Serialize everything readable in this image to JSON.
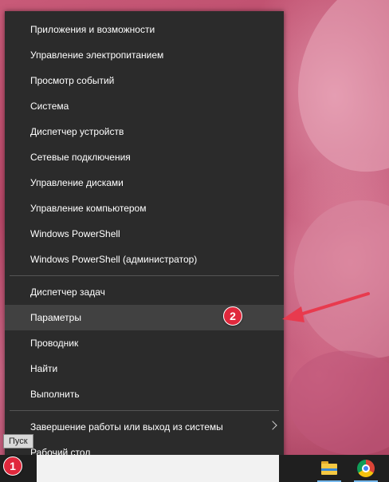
{
  "menu": {
    "items": [
      {
        "label": "Приложения и возможности"
      },
      {
        "label": "Управление электропитанием"
      },
      {
        "label": "Просмотр событий"
      },
      {
        "label": "Система"
      },
      {
        "label": "Диспетчер устройств"
      },
      {
        "label": "Сетевые подключения"
      },
      {
        "label": "Управление дисками"
      },
      {
        "label": "Управление компьютером"
      },
      {
        "label": "Windows PowerShell"
      },
      {
        "label": "Windows PowerShell (администратор)"
      },
      {
        "label": "Диспетчер задач"
      },
      {
        "label": "Параметры"
      },
      {
        "label": "Проводник"
      },
      {
        "label": "Найти"
      },
      {
        "label": "Выполнить"
      },
      {
        "label": "Завершение работы или выход из системы"
      },
      {
        "label": "Рабочий стол"
      }
    ],
    "highlighted": "Параметры"
  },
  "tooltip": {
    "text": "Пуск"
  },
  "annotations": {
    "badge1": "1",
    "badge2": "2"
  },
  "taskbar": {
    "icons": [
      "folder-icon",
      "chrome-icon"
    ]
  },
  "colors": {
    "menu_bg": "#2b2b2b",
    "highlight_bg": "#414141",
    "badge": "#e0283c",
    "arrow": "#e83a4e",
    "taskbar": "#1f1f1f"
  }
}
